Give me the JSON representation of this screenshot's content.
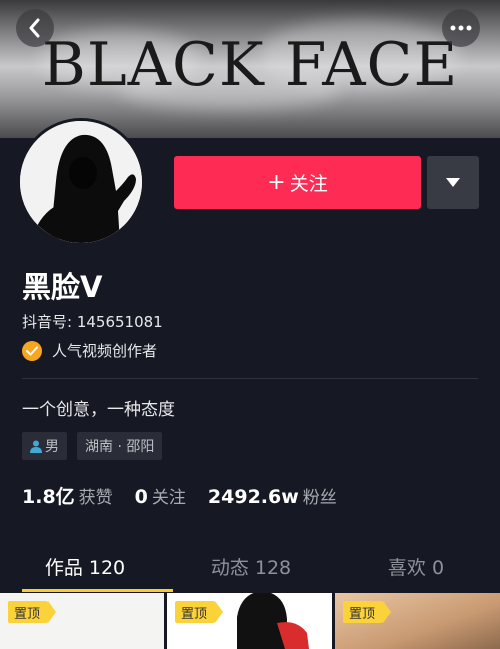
{
  "banner": {
    "title": "BLACK FACE"
  },
  "header": {
    "back_icon": "chevron-left-icon",
    "more_icon": "more-dots-icon"
  },
  "profile": {
    "name": "黑脸V",
    "douyin_id": "抖音号: 145651081",
    "verified_label": "人气视频创作者",
    "bio": "一个创意，一种态度",
    "tags": [
      "男",
      "湖南 · 邵阳"
    ]
  },
  "actions": {
    "follow_label": "关注",
    "dropdown_icon": "triangle-down-icon"
  },
  "stats": [
    {
      "value": "1.8亿",
      "label": "获赞"
    },
    {
      "value": "0",
      "label": "关注"
    },
    {
      "value": "2492.6w",
      "label": "粉丝"
    }
  ],
  "tabs": [
    {
      "label": "作品 120"
    },
    {
      "label": "动态 128"
    },
    {
      "label": "喜欢 0"
    }
  ],
  "videos": [
    {
      "badge": "置顶"
    },
    {
      "badge": "置顶"
    },
    {
      "badge": "置顶"
    }
  ],
  "colors": {
    "accent": "#fe2c55",
    "background": "#161823",
    "tab_underline": "#facd2e",
    "pin_badge": "#fcd23a"
  }
}
